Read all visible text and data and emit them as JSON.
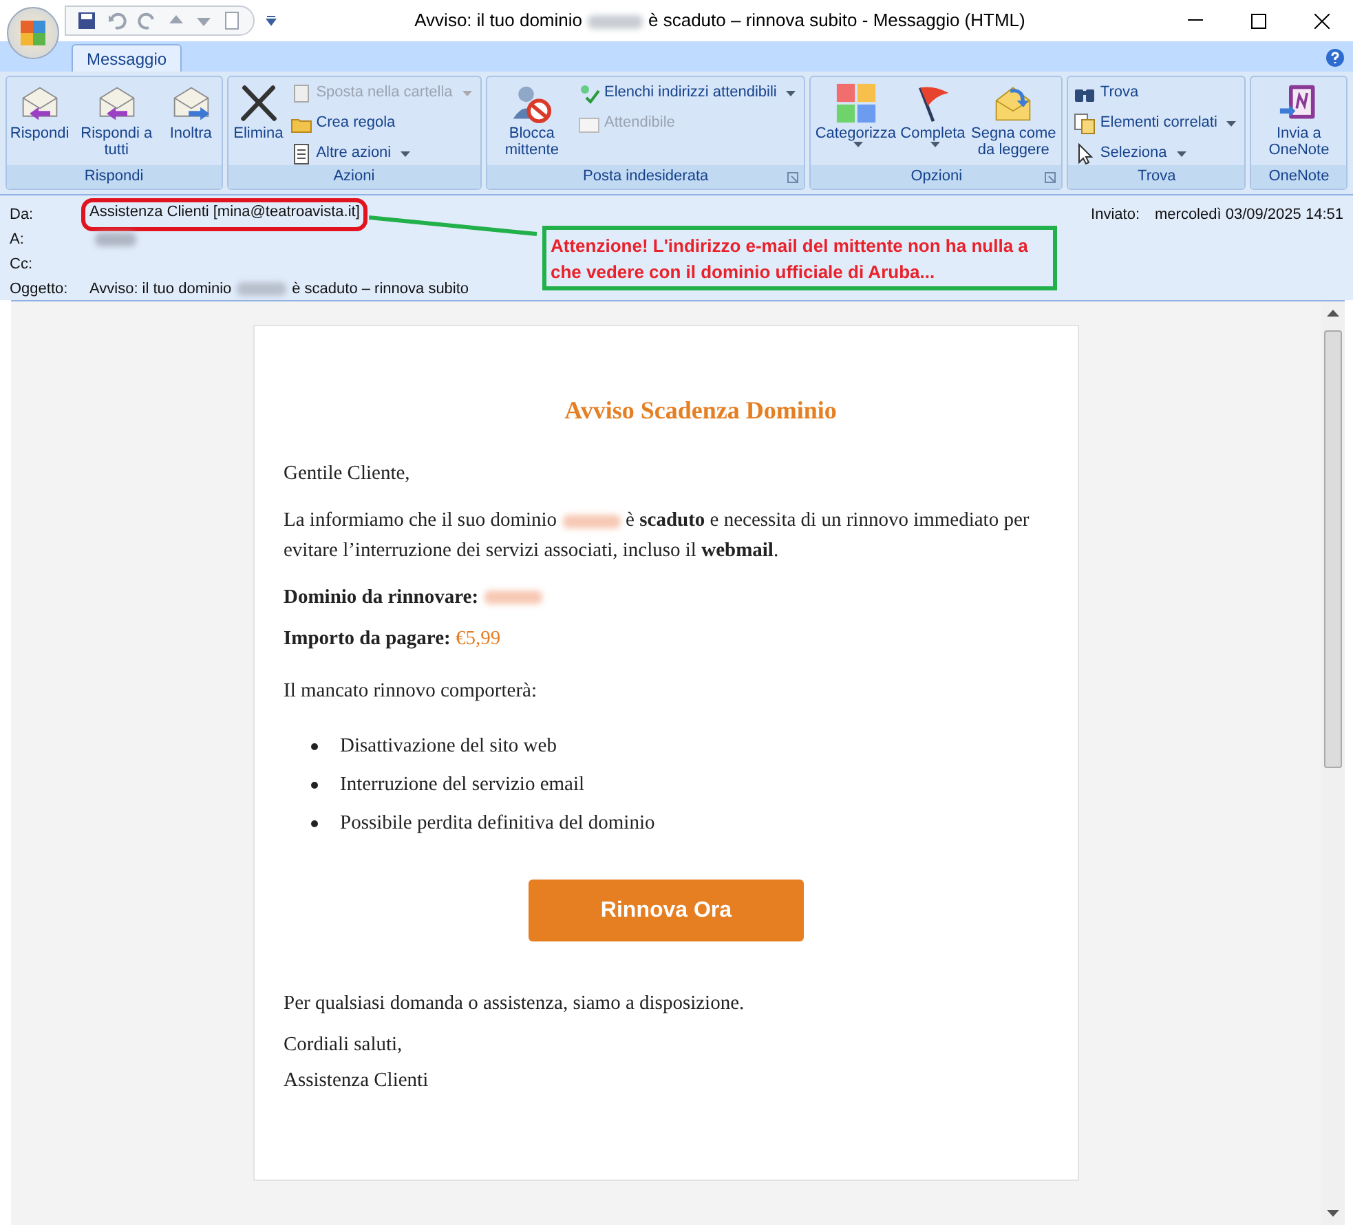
{
  "window": {
    "title_before": "Avviso: il tuo dominio",
    "title_after": "è scaduto – rinnova subito - Messaggio (HTML)"
  },
  "ribbon": {
    "tabs": [
      {
        "label": "Messaggio",
        "selected": true
      }
    ],
    "groups": [
      {
        "name": "Rispondi",
        "launcher": false,
        "items": [
          {
            "kind": "large",
            "label": "Rispondi",
            "disabled": false,
            "dropdown": false
          },
          {
            "kind": "large",
            "label": "Rispondi a tutti",
            "disabled": false,
            "dropdown": false
          },
          {
            "kind": "large",
            "label": "Inoltra",
            "disabled": false,
            "dropdown": false
          }
        ]
      },
      {
        "name": "Azioni",
        "launcher": false,
        "items": [
          {
            "kind": "large",
            "label": "Elimina",
            "disabled": false,
            "dropdown": false
          },
          {
            "kind": "small",
            "label": "Sposta nella cartella",
            "disabled": true,
            "dropdown": true
          },
          {
            "kind": "small",
            "label": "Crea regola",
            "disabled": false,
            "dropdown": false
          },
          {
            "kind": "small",
            "label": "Altre azioni",
            "disabled": false,
            "dropdown": true
          }
        ]
      },
      {
        "name": "Posta indesiderata",
        "launcher": true,
        "items": [
          {
            "kind": "large",
            "label": "Blocca mittente",
            "disabled": false,
            "dropdown": false
          },
          {
            "kind": "small",
            "label": "Elenchi indirizzi attendibili",
            "disabled": false,
            "dropdown": true
          },
          {
            "kind": "small",
            "label": "Attendibile",
            "disabled": true,
            "dropdown": false
          }
        ]
      },
      {
        "name": "Opzioni",
        "launcher": true,
        "items": [
          {
            "kind": "large",
            "label": "Categorizza",
            "disabled": false,
            "dropdown": true
          },
          {
            "kind": "large",
            "label": "Completa",
            "disabled": false,
            "dropdown": true
          },
          {
            "kind": "large",
            "label": "Segna come da leggere",
            "disabled": false,
            "dropdown": false
          }
        ]
      },
      {
        "name": "Trova",
        "launcher": false,
        "items": [
          {
            "kind": "small",
            "label": "Trova",
            "disabled": false,
            "dropdown": false
          },
          {
            "kind": "small",
            "label": "Elementi correlati",
            "disabled": false,
            "dropdown": true
          },
          {
            "kind": "small",
            "label": "Seleziona",
            "disabled": false,
            "dropdown": true
          }
        ]
      },
      {
        "name": "OneNote",
        "launcher": false,
        "items": [
          {
            "kind": "large",
            "label": "Invia a OneNote",
            "disabled": false,
            "dropdown": false
          }
        ]
      }
    ]
  },
  "header": {
    "from_label": "Da:",
    "from_value": "Assistenza Clienti [mina@teatroavista.it]",
    "to_label": "A:",
    "cc_label": "Cc:",
    "subject_label": "Oggetto:",
    "subject_before": "Avviso: il tuo dominio",
    "subject_after": "è scaduto – rinnova subito",
    "sent_label": "Inviato:",
    "sent_value": "mercoledì 03/09/2025 14:51"
  },
  "callout": {
    "text": "Attenzione! L'indirizzo e-mail del mittente non ha nulla a che vedere con il dominio ufficiale di Aruba..."
  },
  "email": {
    "title": "Avviso Scadenza Dominio",
    "greeting": "Gentile Cliente,",
    "intro_before": "La informiamo che il suo dominio",
    "intro_after": "è **scaduto** e necessita di un rinnovo immediato per evitare l’interruzione dei servizi associati, incluso il **webmail**.",
    "domain_label": "Dominio da rinnovare:",
    "amount_label": "Importo da pagare:",
    "amount_value": "€5,99",
    "consequences_intro": "Il mancato rinnovo comporterà:",
    "bullets": [
      "Disattivazione del sito web",
      "Interruzione del servizio email",
      "Possibile perdita definitiva del dominio"
    ],
    "button": "Rinnova Ora",
    "closing": "Per qualsiasi domanda o assistenza, siamo a disposizione.",
    "regards": "Cordiali saluti,",
    "signature": "Assistenza Clienti"
  }
}
